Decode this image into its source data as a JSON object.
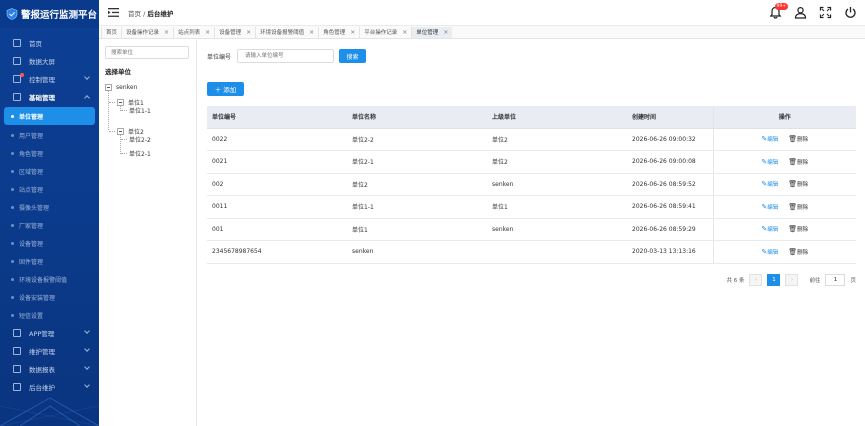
{
  "app": {
    "title": "警报运行监测平台"
  },
  "sidebar": {
    "items": [
      {
        "label": "首页",
        "icon": "home-icon",
        "expandable": false
      },
      {
        "label": "数据大屏",
        "icon": "screen-icon",
        "expandable": false
      },
      {
        "label": "控制管理",
        "icon": "monitor-icon",
        "expandable": true
      },
      {
        "label": "基础管理",
        "icon": "doc-icon",
        "expandable": true,
        "open": true
      },
      {
        "label": "APP管理",
        "icon": "app-icon",
        "expandable": true
      },
      {
        "label": "维护管理",
        "icon": "maint-icon",
        "expandable": true
      },
      {
        "label": "数据报表",
        "icon": "report-icon",
        "expandable": true
      },
      {
        "label": "后台维护",
        "icon": "backend-icon",
        "expandable": true
      }
    ],
    "sub_items": [
      "单位管理",
      "用户管理",
      "角色管理",
      "区域管理",
      "站点管理",
      "摄像头管理",
      "厂家管理",
      "设备管理",
      "固件管理",
      "环境设备报警阈值",
      "设备安装管理",
      "短信设置"
    ],
    "active_sub": "单位管理"
  },
  "header": {
    "breadcrumb_home": "首页",
    "breadcrumb_sep": " / ",
    "breadcrumb_current": "后台维护",
    "notification_badge": "99+"
  },
  "tags": [
    {
      "label": "首页",
      "closable": false
    },
    {
      "label": "设备操作记录",
      "closable": true
    },
    {
      "label": "站点列表",
      "closable": true
    },
    {
      "label": "设备管理",
      "closable": true
    },
    {
      "label": "环境设备报警阈值",
      "closable": true
    },
    {
      "label": "角色管理",
      "closable": true
    },
    {
      "label": "平台操作记录",
      "closable": true
    },
    {
      "label": "单位管理",
      "closable": true,
      "active": true
    }
  ],
  "tree": {
    "search_placeholder": "搜索单位",
    "title": "选择单位",
    "root": "senken",
    "nodes": [
      "单位1",
      "单位1-1",
      "单位2",
      "单位2-2",
      "单位2-1"
    ]
  },
  "filter": {
    "label": "单位编号",
    "placeholder": "请输入单位编号",
    "search_button": "搜索",
    "add_button": "添加"
  },
  "table": {
    "headers": [
      "单位编号",
      "单位名称",
      "上级单位",
      "创建时间",
      "操作"
    ],
    "rows": [
      [
        "0022",
        "单位2-2",
        "单位2",
        "2026-06-26 09:00:32"
      ],
      [
        "0021",
        "单位2-1",
        "单位2",
        "2026-06-26 09:00:08"
      ],
      [
        "002",
        "单位2",
        "senken",
        "2026-06-26 08:59:52"
      ],
      [
        "0011",
        "单位1-1",
        "单位1",
        "2026-06-26 08:59:41"
      ],
      [
        "001",
        "单位1",
        "senken",
        "2026-06-26 08:59:29"
      ],
      [
        "2345678987654",
        "senken",
        "",
        "2020-03-13 13:13:16"
      ]
    ],
    "edit_label": "编辑",
    "delete_label": "删除"
  },
  "pagination": {
    "total_text": "共 6 条",
    "current_page": "1",
    "goto_label": "前往",
    "goto_value": "1",
    "page_unit": "页"
  },
  "colors": {
    "sidebar_bg": "#0b3a8a",
    "accent": "#1e8fe8",
    "badge": "#ff3333"
  }
}
